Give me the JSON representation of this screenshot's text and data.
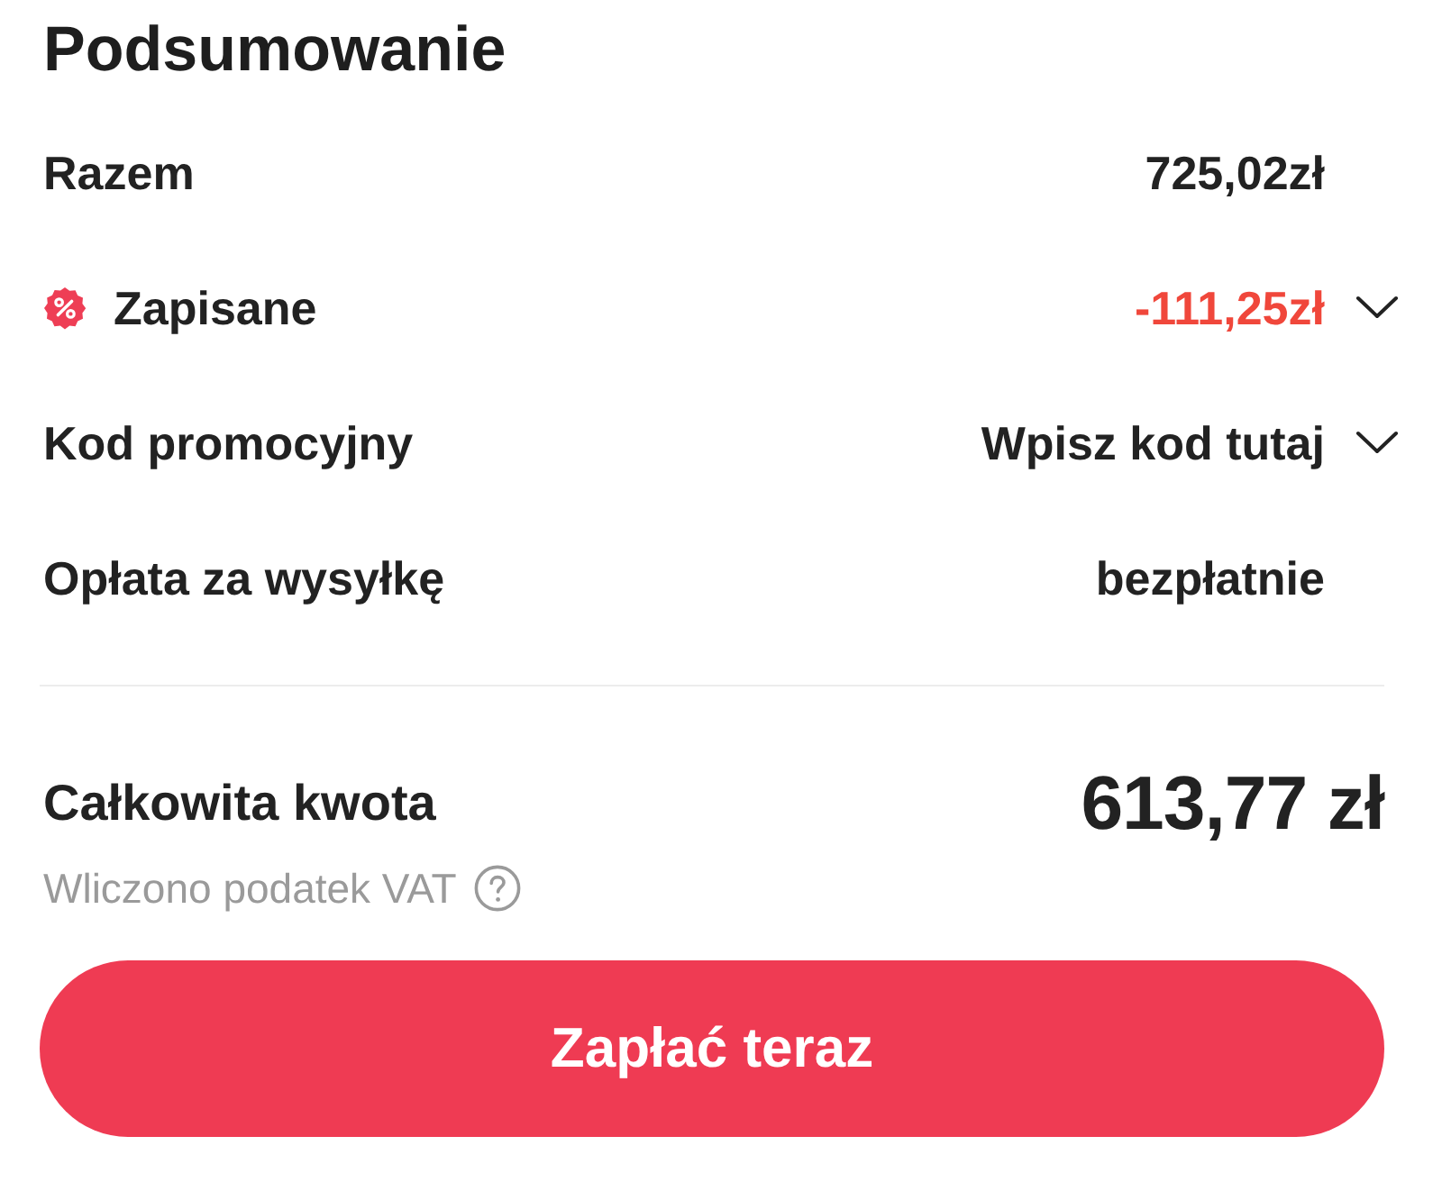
{
  "title": "Podsumowanie",
  "rows": [
    {
      "kind": "amount",
      "label": "Razem",
      "value": "725,02zł"
    },
    {
      "kind": "discount",
      "label": "Zapisane",
      "value": "-111,25zł"
    },
    {
      "kind": "select",
      "label": "Kod promocyjny",
      "value": "Wpisz kod tutaj"
    },
    {
      "kind": "amount",
      "label": "Opłata za wysyłkę",
      "value": "bezpłatnie"
    }
  ],
  "total": {
    "label": "Całkowita kwota",
    "value": "613,77 zł",
    "note": "Wliczono podatek VAT"
  },
  "pay_button": {
    "label": "Zapłać teraz"
  }
}
